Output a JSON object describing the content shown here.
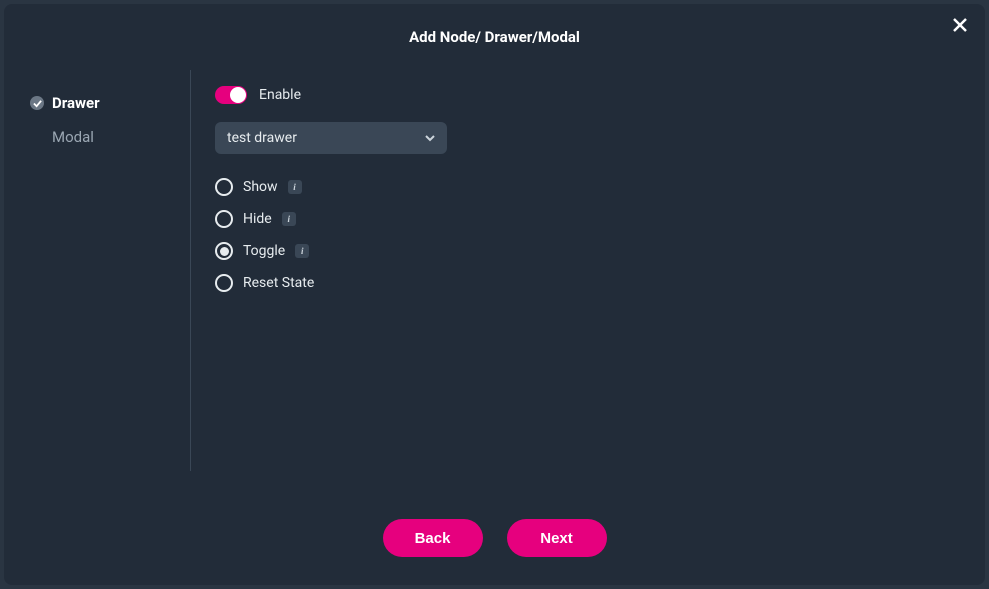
{
  "header": {
    "title": "Add Node/ Drawer/Modal"
  },
  "sidebar": {
    "items": [
      {
        "label": "Drawer",
        "active": true
      },
      {
        "label": "Modal",
        "active": false
      }
    ]
  },
  "content": {
    "enable_label": "Enable",
    "enable_value": true,
    "select_value": "test drawer",
    "options": [
      {
        "label": "Show",
        "info": true,
        "selected": false
      },
      {
        "label": "Hide",
        "info": true,
        "selected": false
      },
      {
        "label": "Toggle",
        "info": true,
        "selected": true
      },
      {
        "label": "Reset State",
        "info": false,
        "selected": false
      }
    ]
  },
  "footer": {
    "back_label": "Back",
    "next_label": "Next"
  },
  "colors": {
    "accent": "#e6007e"
  }
}
